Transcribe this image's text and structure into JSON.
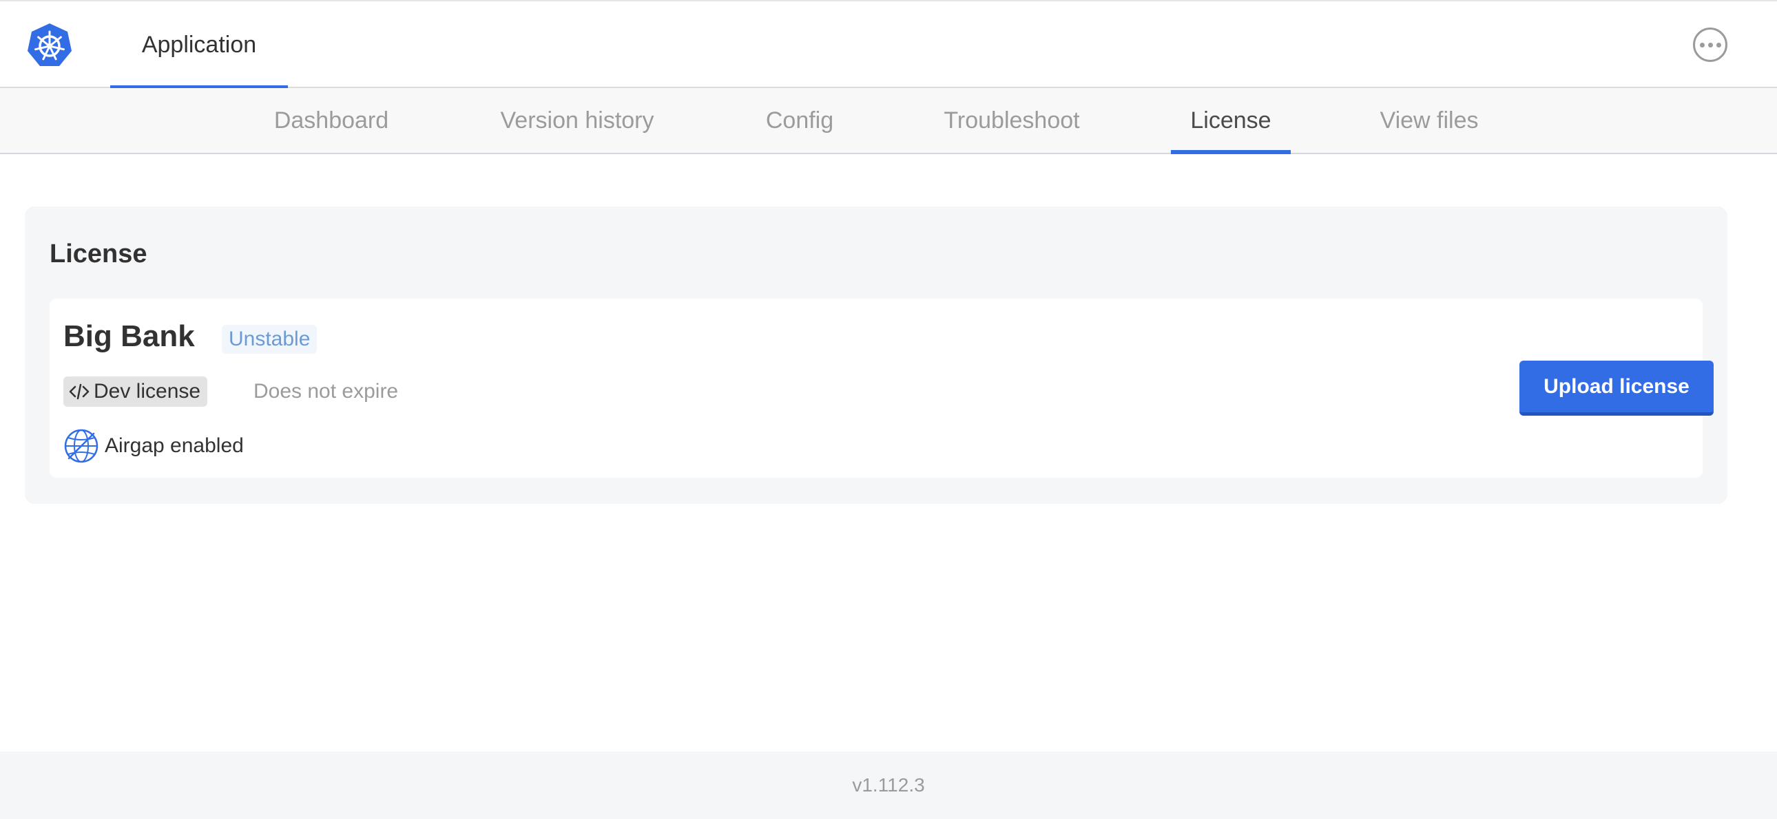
{
  "header": {
    "logo_icon": "kubernetes-helm-icon",
    "app_tab_label": "Application",
    "more_icon": "more-options-icon"
  },
  "subnav": {
    "tabs": [
      {
        "label": "Dashboard",
        "active": false
      },
      {
        "label": "Version history",
        "active": false
      },
      {
        "label": "Config",
        "active": false
      },
      {
        "label": "Troubleshoot",
        "active": false
      },
      {
        "label": "License",
        "active": true
      },
      {
        "label": "View files",
        "active": false
      }
    ]
  },
  "license": {
    "section_title": "License",
    "customer_name": "Big Bank",
    "channel": "Unstable",
    "license_type": "Dev license",
    "expiration": "Does not expire",
    "airgap_label": "Airgap enabled",
    "upload_button": "Upload license"
  },
  "footer": {
    "version": "v1.112.3"
  },
  "colors": {
    "accent": "#326de6",
    "channel_text": "#6b9bd6",
    "muted_text": "#9b9b9b",
    "panel_bg": "#f5f6f8"
  }
}
